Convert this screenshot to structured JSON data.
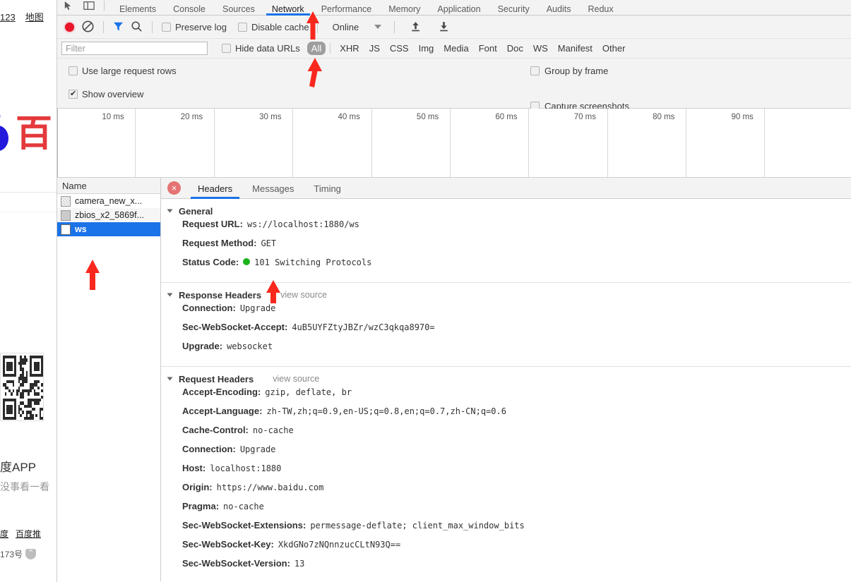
{
  "background_page": {
    "nav_links": [
      "123",
      "地图"
    ],
    "logo_text": "百",
    "app_title": "度APP",
    "app_sub": "没事看一看",
    "footer_links": [
      "度",
      "百度推"
    ],
    "footer_text": "173号"
  },
  "devtools": {
    "tabs": [
      {
        "label": "Elements",
        "active": false
      },
      {
        "label": "Console",
        "active": false
      },
      {
        "label": "Sources",
        "active": false
      },
      {
        "label": "Network",
        "active": true
      },
      {
        "label": "Performance",
        "active": false
      },
      {
        "label": "Memory",
        "active": false
      },
      {
        "label": "Application",
        "active": false
      },
      {
        "label": "Security",
        "active": false
      },
      {
        "label": "Audits",
        "active": false
      },
      {
        "label": "Redux",
        "active": false
      }
    ],
    "toolbar": {
      "record_icon": "record-icon",
      "clear_icon": "clear-icon",
      "filter_icon": "filter-funnel-icon",
      "search_icon": "search-icon",
      "preserve_log_label": "Preserve log",
      "preserve_log_checked": false,
      "disable_cache_label": "Disable cache",
      "disable_cache_checked": false,
      "throttle_value": "Online",
      "import_icon": "import-har-icon",
      "export_icon": "export-har-icon"
    },
    "filter_row": {
      "filter_placeholder": "Filter",
      "filter_value": "",
      "hide_data_urls_label": "Hide data URLs",
      "hide_data_urls_checked": false,
      "types": [
        "All",
        "XHR",
        "JS",
        "CSS",
        "Img",
        "Media",
        "Font",
        "Doc",
        "WS",
        "Manifest",
        "Other"
      ],
      "selected_type": "All"
    },
    "options": {
      "use_large_rows_label": "Use large request rows",
      "use_large_rows_checked": false,
      "show_overview_label": "Show overview",
      "show_overview_checked": true,
      "group_by_frame_label": "Group by frame",
      "group_by_frame_checked": false,
      "capture_screenshots_label": "Capture screenshots",
      "capture_screenshots_checked": false
    },
    "overview": {
      "ticks": [
        "10 ms",
        "20 ms",
        "30 ms",
        "40 ms",
        "50 ms",
        "60 ms",
        "70 ms",
        "80 ms",
        "90 ms"
      ]
    },
    "request_list": {
      "column_header": "Name",
      "rows": [
        {
          "name": "camera_new_x...",
          "icon": "image-file-icon",
          "selected": false
        },
        {
          "name": "zbios_x2_5869f...",
          "icon": "image-file-icon",
          "selected": false
        },
        {
          "name": "ws",
          "icon": "document-file-icon",
          "selected": true
        }
      ]
    },
    "detail": {
      "error_badge": "×",
      "tabs": [
        {
          "label": "Headers",
          "active": true
        },
        {
          "label": "Messages",
          "active": false
        },
        {
          "label": "Timing",
          "active": false
        }
      ],
      "sections": [
        {
          "title": "General",
          "view_source": "",
          "rows": [
            {
              "key": "Request URL:",
              "value": "ws://localhost:1880/ws",
              "status_dot": false
            },
            {
              "key": "Request Method:",
              "value": "GET",
              "status_dot": false
            },
            {
              "key": "Status Code:",
              "value": "101 Switching Protocols",
              "status_dot": true
            }
          ]
        },
        {
          "title": "Response Headers",
          "view_source": "view source",
          "rows": [
            {
              "key": "Connection:",
              "value": "Upgrade",
              "status_dot": false
            },
            {
              "key": "Sec-WebSocket-Accept:",
              "value": "4uB5UYFZtyJBZr/wzC3qkqa8970=",
              "status_dot": false
            },
            {
              "key": "Upgrade:",
              "value": "websocket",
              "status_dot": false
            }
          ]
        },
        {
          "title": "Request Headers",
          "view_source": "view source",
          "rows": [
            {
              "key": "Accept-Encoding:",
              "value": "gzip, deflate, br",
              "status_dot": false
            },
            {
              "key": "Accept-Language:",
              "value": "zh-TW,zh;q=0.9,en-US;q=0.8,en;q=0.7,zh-CN;q=0.6",
              "status_dot": false
            },
            {
              "key": "Cache-Control:",
              "value": "no-cache",
              "status_dot": false
            },
            {
              "key": "Connection:",
              "value": "Upgrade",
              "status_dot": false
            },
            {
              "key": "Host:",
              "value": "localhost:1880",
              "status_dot": false
            },
            {
              "key": "Origin:",
              "value": "https://www.baidu.com",
              "status_dot": false
            },
            {
              "key": "Pragma:",
              "value": "no-cache",
              "status_dot": false
            },
            {
              "key": "Sec-WebSocket-Extensions:",
              "value": "permessage-deflate; client_max_window_bits",
              "status_dot": false
            },
            {
              "key": "Sec-WebSocket-Key:",
              "value": "XkdGNo7zNQnnzucCLtN93Q==",
              "status_dot": false
            },
            {
              "key": "Sec-WebSocket-Version:",
              "value": "13",
              "status_dot": false
            }
          ]
        }
      ]
    }
  },
  "annotations": {
    "arrow_color": "#f9281e",
    "arrows": [
      "network-tab-arrow",
      "all-filter-arrow",
      "ws-request-arrow",
      "status-code-arrow"
    ]
  },
  "colors": {
    "accent_blue": "#1a73e8",
    "selected_row_blue": "#1a73e8",
    "toolbar_bg": "#f3f3f3",
    "record_red": "#e8152b",
    "status_green": "#19b319",
    "annotation_red": "#f9281e",
    "baidu_blue": "#2319dc",
    "baidu_red": "#e4393c"
  }
}
